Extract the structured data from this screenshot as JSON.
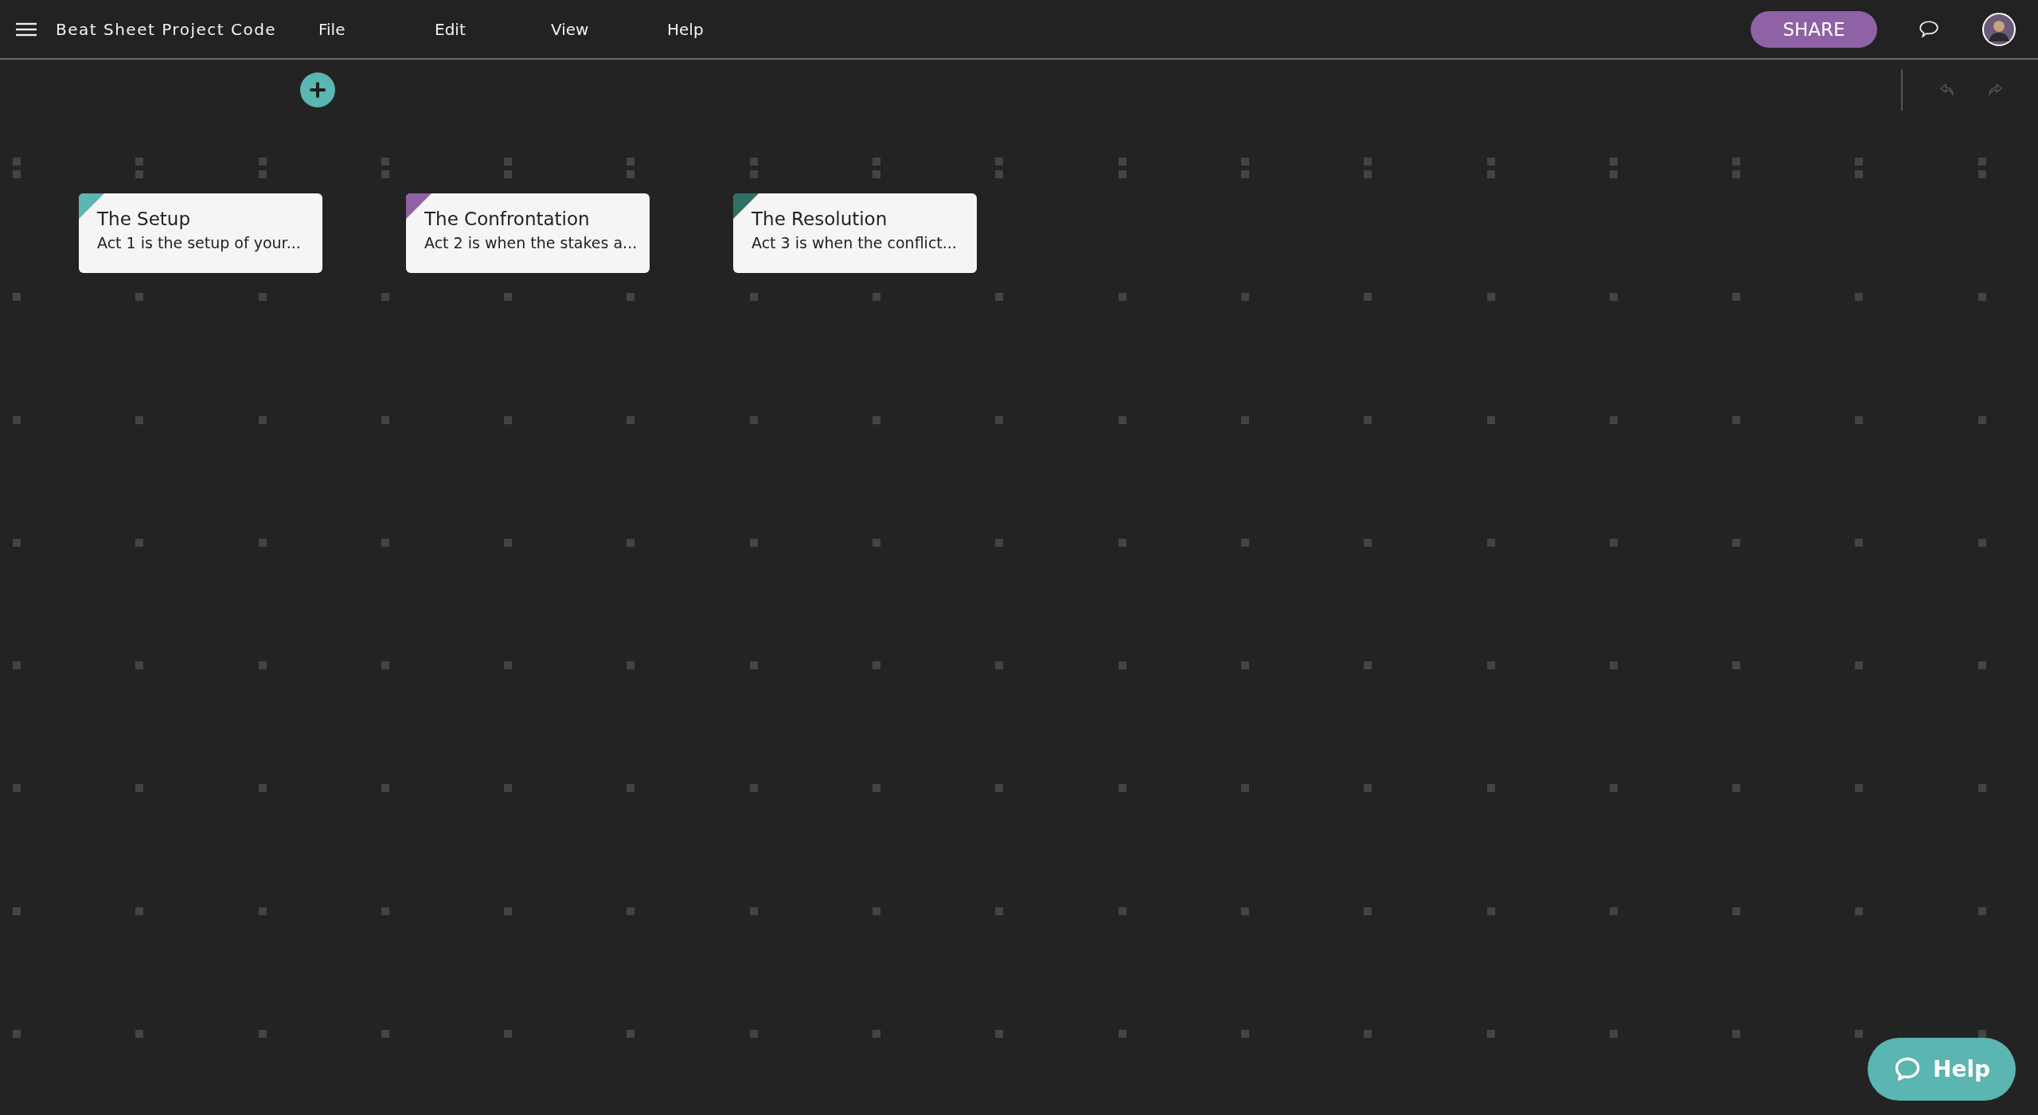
{
  "app_bar": {
    "project_title": "Beat Sheet Project Code",
    "menus": [
      "File",
      "Edit",
      "View",
      "Help"
    ],
    "share_label": "SHARE"
  },
  "cards": [
    {
      "title": "The Setup",
      "summary": "Act 1 is the setup of your...",
      "color": "#5bb5b1"
    },
    {
      "title": "The Confrontation",
      "summary": "Act 2 is when the stakes a...",
      "color": "#8e62a4"
    },
    {
      "title": "The Resolution",
      "summary": "Act 3 is when the conflict...",
      "color": "#2f7066"
    }
  ],
  "help_button": {
    "label": "Help"
  }
}
